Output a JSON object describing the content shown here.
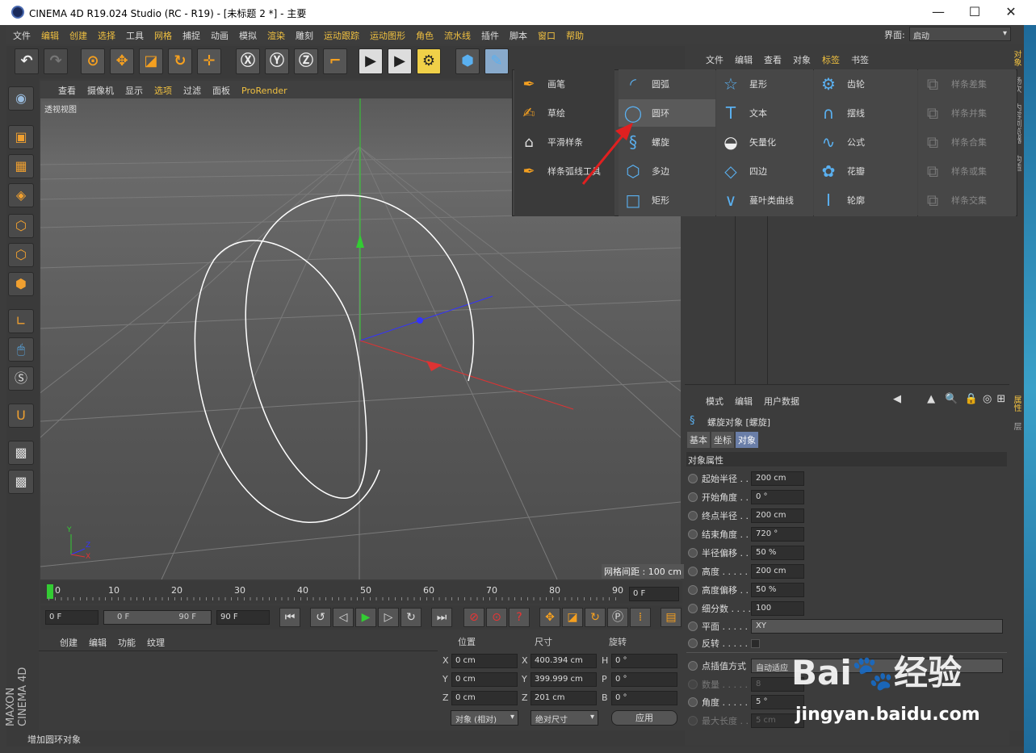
{
  "window": {
    "title": "CINEMA 4D R19.024 Studio (RC - R19) - [未标题 2 *] - 主要",
    "minimize": "—",
    "maximize": "☐",
    "close": "✕"
  },
  "menubar": {
    "items": [
      "文件",
      "编辑",
      "创建",
      "选择",
      "工具",
      "网格",
      "捕捉",
      "动画",
      "模拟",
      "渲染",
      "雕刻",
      "运动跟踪",
      "运动图形",
      "角色",
      "流水线",
      "插件",
      "脚本",
      "窗口",
      "帮助"
    ],
    "layout_label": "界面:",
    "layout_value": "启动"
  },
  "viewport": {
    "menu": [
      "查看",
      "摄像机",
      "显示",
      "选项",
      "过滤",
      "面板",
      "ProRender"
    ],
    "label": "透视视图",
    "grid_info": "网格间距 : 100 cm",
    "axes": {
      "y": "Y",
      "z": "Z",
      "x": "X"
    }
  },
  "timeline": {
    "ticks": [
      "0",
      "10",
      "20",
      "30",
      "40",
      "50",
      "60",
      "70",
      "80",
      "90"
    ],
    "current_frame": "0 F"
  },
  "playback": {
    "start": "0 F",
    "range_start": "0 F",
    "range_end": "90 F",
    "end": "90 F"
  },
  "object_manager": {
    "menu": [
      "文件",
      "编辑",
      "查看",
      "对象",
      "标签",
      "书签"
    ],
    "side_tabs": [
      "对象",
      "场次",
      "内容浏览器",
      "构造"
    ]
  },
  "dropdown": {
    "col1": [
      "画笔",
      "草绘",
      "平滑样条",
      "样条弧线工具"
    ],
    "col2": [
      "圆弧",
      "圆环",
      "螺旋",
      "多边",
      "矩形"
    ],
    "col3": [
      "星形",
      "文本",
      "矢量化",
      "四边",
      "蔓叶类曲线"
    ],
    "col4": [
      "齿轮",
      "摆线",
      "公式",
      "花瓣",
      "轮廓"
    ],
    "col5": [
      "样条差集",
      "样条并集",
      "样条合集",
      "样条或集",
      "样条交集"
    ],
    "selected": "圆环"
  },
  "attributes": {
    "menu": [
      "模式",
      "编辑",
      "用户数据"
    ],
    "object_title": "螺旋对象 [螺旋]",
    "tabs": [
      "基本",
      "坐标",
      "对象"
    ],
    "section": "对象属性",
    "rows": [
      {
        "label": "起始半径 . .",
        "value": "200 cm"
      },
      {
        "label": "开始角度 . .",
        "value": "0 °"
      },
      {
        "label": "终点半径 . .",
        "value": "200 cm"
      },
      {
        "label": "结束角度 . .",
        "value": "720 °"
      },
      {
        "label": "半径偏移 . .",
        "value": "50 %"
      },
      {
        "label": "高度 . . . . .",
        "value": "200 cm"
      },
      {
        "label": "高度偏移 . .",
        "value": "50 %"
      },
      {
        "label": "细分数 . . . .",
        "value": "100"
      },
      {
        "label": "平面 . . . . .",
        "value": "XY"
      },
      {
        "label": "反转 . . . . .",
        "value": ""
      },
      {
        "label": "点插值方式",
        "value": "自动适应"
      },
      {
        "label": "数量 . . . . .",
        "value": "8"
      },
      {
        "label": "角度 . . . . .",
        "value": "5 °"
      },
      {
        "label": "最大长度 . .",
        "value": "5 cm"
      }
    ],
    "side_tabs": [
      "属性",
      "层"
    ]
  },
  "material_manager": {
    "menu": [
      "创建",
      "编辑",
      "功能",
      "纹理"
    ]
  },
  "coords": {
    "headers": [
      "位置",
      "尺寸",
      "旋转"
    ],
    "rows": [
      {
        "a": "X",
        "pos": "0 cm",
        "b": "X",
        "size": "400.394 cm",
        "c": "H",
        "rot": "0 °"
      },
      {
        "a": "Y",
        "pos": "0 cm",
        "b": "Y",
        "size": "399.999 cm",
        "c": "P",
        "rot": "0 °"
      },
      {
        "a": "Z",
        "pos": "0 cm",
        "b": "Z",
        "size": "201 cm",
        "c": "B",
        "rot": "0 °"
      }
    ],
    "mode": "对象 (相对)",
    "size_mode": "绝对尺寸",
    "apply": "应用"
  },
  "status": "增加圆环对象",
  "watermark": {
    "brand": "Bai🐾经验",
    "url": "jingyan.baidu.com"
  },
  "logo": "MAXON CINEMA 4D"
}
